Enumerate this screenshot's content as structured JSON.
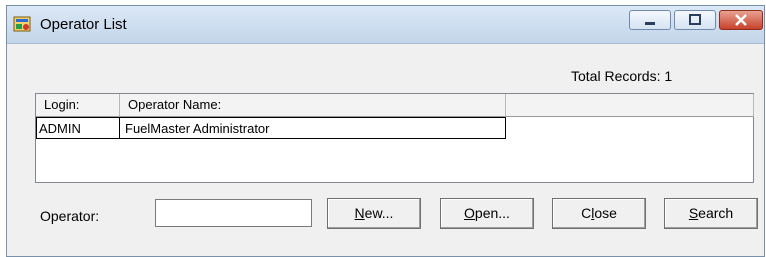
{
  "window": {
    "title": "Operator List"
  },
  "summary": {
    "total_records": "Total Records: 1"
  },
  "table": {
    "headers": [
      "Login:",
      "Operator Name:",
      ""
    ],
    "rows": [
      {
        "login": "ADMIN",
        "operator_name": "FuelMaster  Administrator"
      }
    ]
  },
  "search": {
    "operator_label": "Operator:",
    "operator_value": ""
  },
  "buttons": {
    "new": {
      "accel": "N",
      "rest": "ew..."
    },
    "open": {
      "accel": "O",
      "rest": "pen..."
    },
    "close": {
      "pre": "C",
      "accel": "l",
      "rest": "ose"
    },
    "search": {
      "accel": "S",
      "rest": "earch"
    }
  },
  "icons": {
    "app": "operator-list-app-icon",
    "minimize": "minimize-icon",
    "maximize": "maximize-icon",
    "close": "close-icon"
  }
}
